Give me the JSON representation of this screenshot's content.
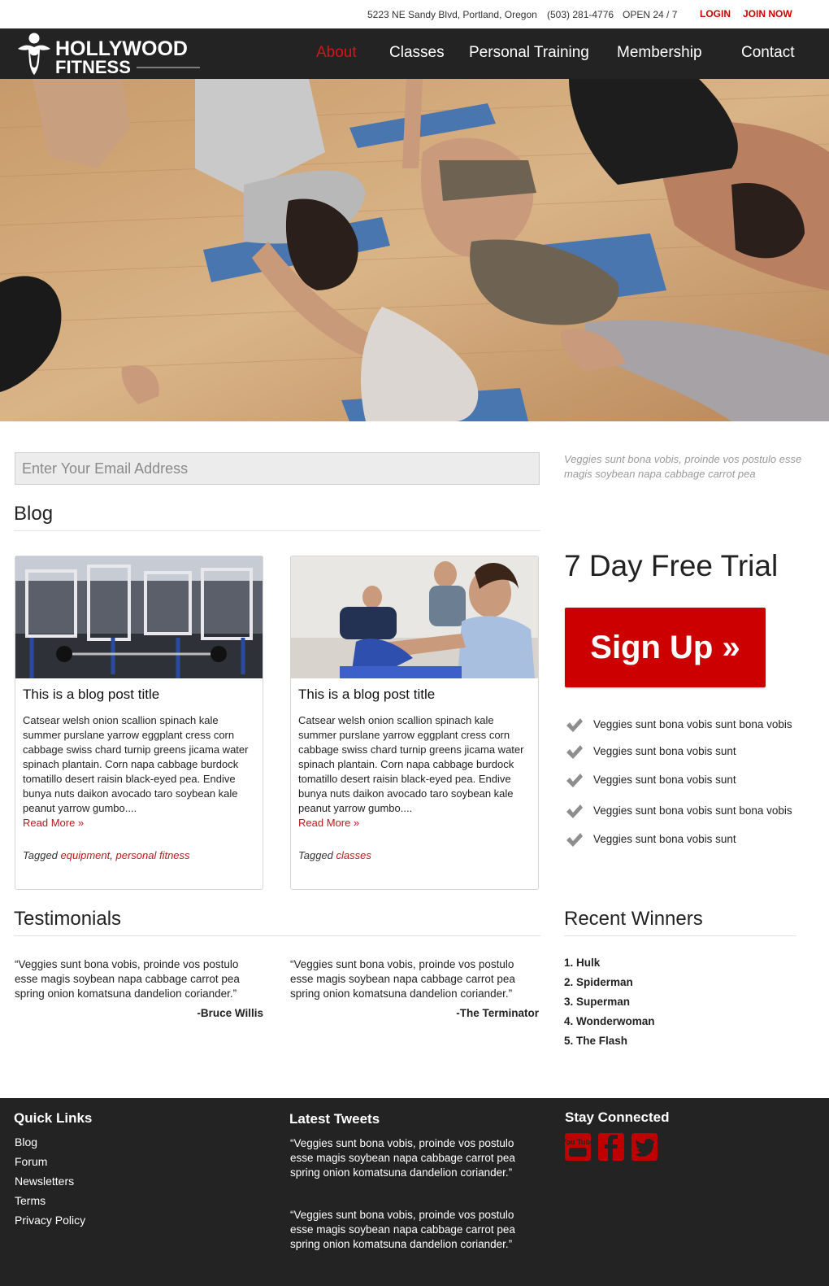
{
  "topbar": {
    "address": "5223 NE Sandy Blvd, Portland, Oregon",
    "phone": "(503) 281-4776",
    "hours": "OPEN 24 / 7",
    "login": "LOGIN",
    "join": "JOIN NOW"
  },
  "logo": {
    "line1": "HOLLYWOOD",
    "line2": "FITNESS"
  },
  "nav": {
    "items": [
      {
        "label": "About",
        "active": true
      },
      {
        "label": "Classes"
      },
      {
        "label": "Personal Training"
      },
      {
        "label": "Membership"
      },
      {
        "label": "Contact"
      }
    ]
  },
  "email": {
    "placeholder": "Enter Your Email Address"
  },
  "side_quote": "Veggies sunt bona vobis, proinde vos postulo esse magis soybean napa cabbage carrot pea",
  "blog": {
    "heading": "Blog",
    "posts": [
      {
        "title": "This is a blog post title",
        "body": "Catsear welsh onion scallion spinach kale summer purslane yarrow eggplant cress corn cabbage swiss chard turnip greens jicama water spinach plantain. Corn napa cabbage burdock tomatillo desert raisin black-eyed pea. Endive bunya nuts daikon avocado taro soybean kale peanut yarrow gumbo....",
        "read_more": "Read More »",
        "tagged": "Tagged",
        "tag1": "equipment",
        "sep": ", ",
        "tag2": "personal fitness"
      },
      {
        "title": "This is a blog post title",
        "body": "Catsear welsh onion scallion spinach kale summer purslane yarrow eggplant cress corn cabbage swiss chard turnip greens jicama water spinach plantain. Corn napa cabbage burdock tomatillo desert raisin black-eyed pea. Endive bunya nuts daikon avocado taro soybean kale peanut yarrow gumbo....",
        "read_more": "Read More »",
        "tagged": "Tagged",
        "tag1": "classes"
      }
    ]
  },
  "trial": {
    "heading": "7 Day Free Trial",
    "button": "Sign Up »",
    "checks": [
      "Veggies sunt bona vobis sunt bona vobis",
      "Veggies sunt bona vobis sunt",
      "Veggies sunt bona vobis sunt",
      "Veggies sunt bona vobis sunt bona vobis",
      "Veggies sunt bona vobis sunt"
    ]
  },
  "testimonials": {
    "heading": "Testimonials",
    "items": [
      {
        "quote": "“Veggies sunt bona vobis, proinde vos postulo esse magis soybean napa cabbage carrot pea spring onion komatsuna dandelion coriander.”",
        "author": "-Bruce Willis"
      },
      {
        "quote": "“Veggies sunt bona vobis, proinde vos postulo esse magis soybean napa cabbage carrot pea spring onion komatsuna dandelion coriander.”",
        "author": "-The Terminator"
      }
    ]
  },
  "winners": {
    "heading": "Recent Winners",
    "items": [
      "1. Hulk",
      "2. Spiderman",
      "3. Superman",
      "4. Wonderwoman",
      "5. The Flash"
    ]
  },
  "footer": {
    "quick_links": {
      "heading": "Quick Links",
      "items": [
        "Blog",
        "Forum",
        "Newsletters",
        "Terms",
        "Privacy Policy"
      ]
    },
    "tweets": {
      "heading": "Latest Tweets",
      "items": [
        "“Veggies sunt bona vobis, proinde vos postulo esse magis soybean napa cabbage carrot pea spring onion komatsuna dandelion coriander.”",
        "“Veggies sunt bona vobis, proinde vos postulo esse magis soybean napa cabbage carrot pea spring onion komatsuna dandelion coriander.”"
      ]
    },
    "social": {
      "heading": "Stay Connected",
      "youtube_label": "You Tube",
      "icons": [
        "youtube-icon",
        "facebook-icon",
        "twitter-icon"
      ]
    }
  },
  "colors": {
    "accent": "#cc0000",
    "dark": "#232323",
    "muted": "#9a9a9a"
  }
}
